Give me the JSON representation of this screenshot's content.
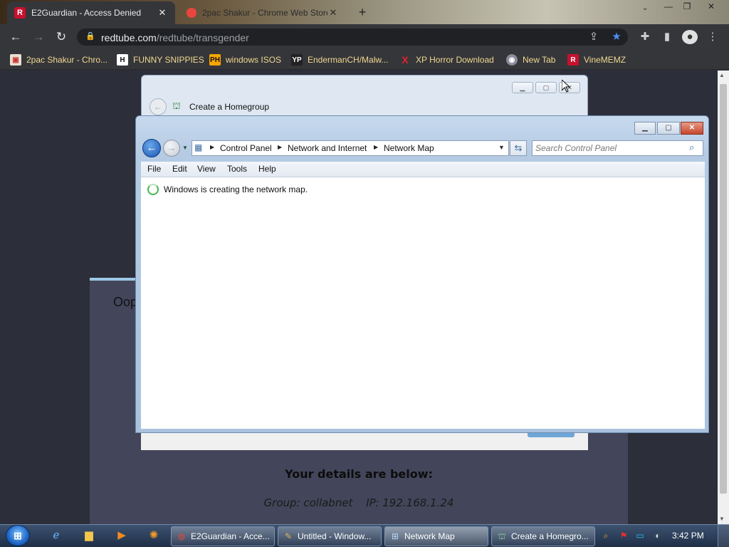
{
  "browser": {
    "tabs": [
      {
        "title": "E2Guardian - Access Denied",
        "favicon": "R",
        "close": "✕"
      },
      {
        "title": "2pac Shakur - Chrome Web Store",
        "close": "✕"
      }
    ],
    "new_tab": "+",
    "address": {
      "domain": "redtube.com",
      "path": "/redtube/transgender"
    },
    "bookmarks": [
      {
        "label": "2pac Shakur - Chro...",
        "icon": "webstore-icon"
      },
      {
        "label": "FUNNY SNIPPIES",
        "icon": "H"
      },
      {
        "label": "windows ISOS",
        "icon": "PH"
      },
      {
        "label": "EndermanCH/Malw...",
        "icon": "YP"
      },
      {
        "label": "XP Horror Download",
        "icon": "X"
      },
      {
        "label": "New Tab",
        "icon": "globe-icon"
      },
      {
        "label": "VineMEMZ",
        "icon": "R"
      }
    ]
  },
  "blocked_page": {
    "heading_fragment": "Oop",
    "details_title": "Your details are below:",
    "group": "Group: collabnet",
    "ip": "IP: 192.168.1.24"
  },
  "homegroup_window": {
    "title": "Create a Homegroup"
  },
  "network_map_window": {
    "breadcrumbs": [
      "Control Panel",
      "Network and Internet",
      "Network Map"
    ],
    "search_placeholder": "Search Control Panel",
    "menu": [
      "File",
      "Edit",
      "View",
      "Tools",
      "Help"
    ],
    "status": "Windows is creating the network map."
  },
  "taskbar": {
    "tasks": [
      {
        "label": "E2Guardian - Acce...",
        "icon": "chrome-icon"
      },
      {
        "label": "Untitled - Window...",
        "icon": "paint-icon"
      },
      {
        "label": "Network Map",
        "icon": "network-icon"
      },
      {
        "label": "Create a Homegro...",
        "icon": "homegroup-icon"
      }
    ],
    "clock": "3:42 PM"
  },
  "colors": {
    "chrome_dark": "#35363a",
    "bookmark_text": "#f0d890",
    "aero_blue": "#a9c2de",
    "close_red": "#c7472c",
    "page_bg": "#2c2e39"
  }
}
